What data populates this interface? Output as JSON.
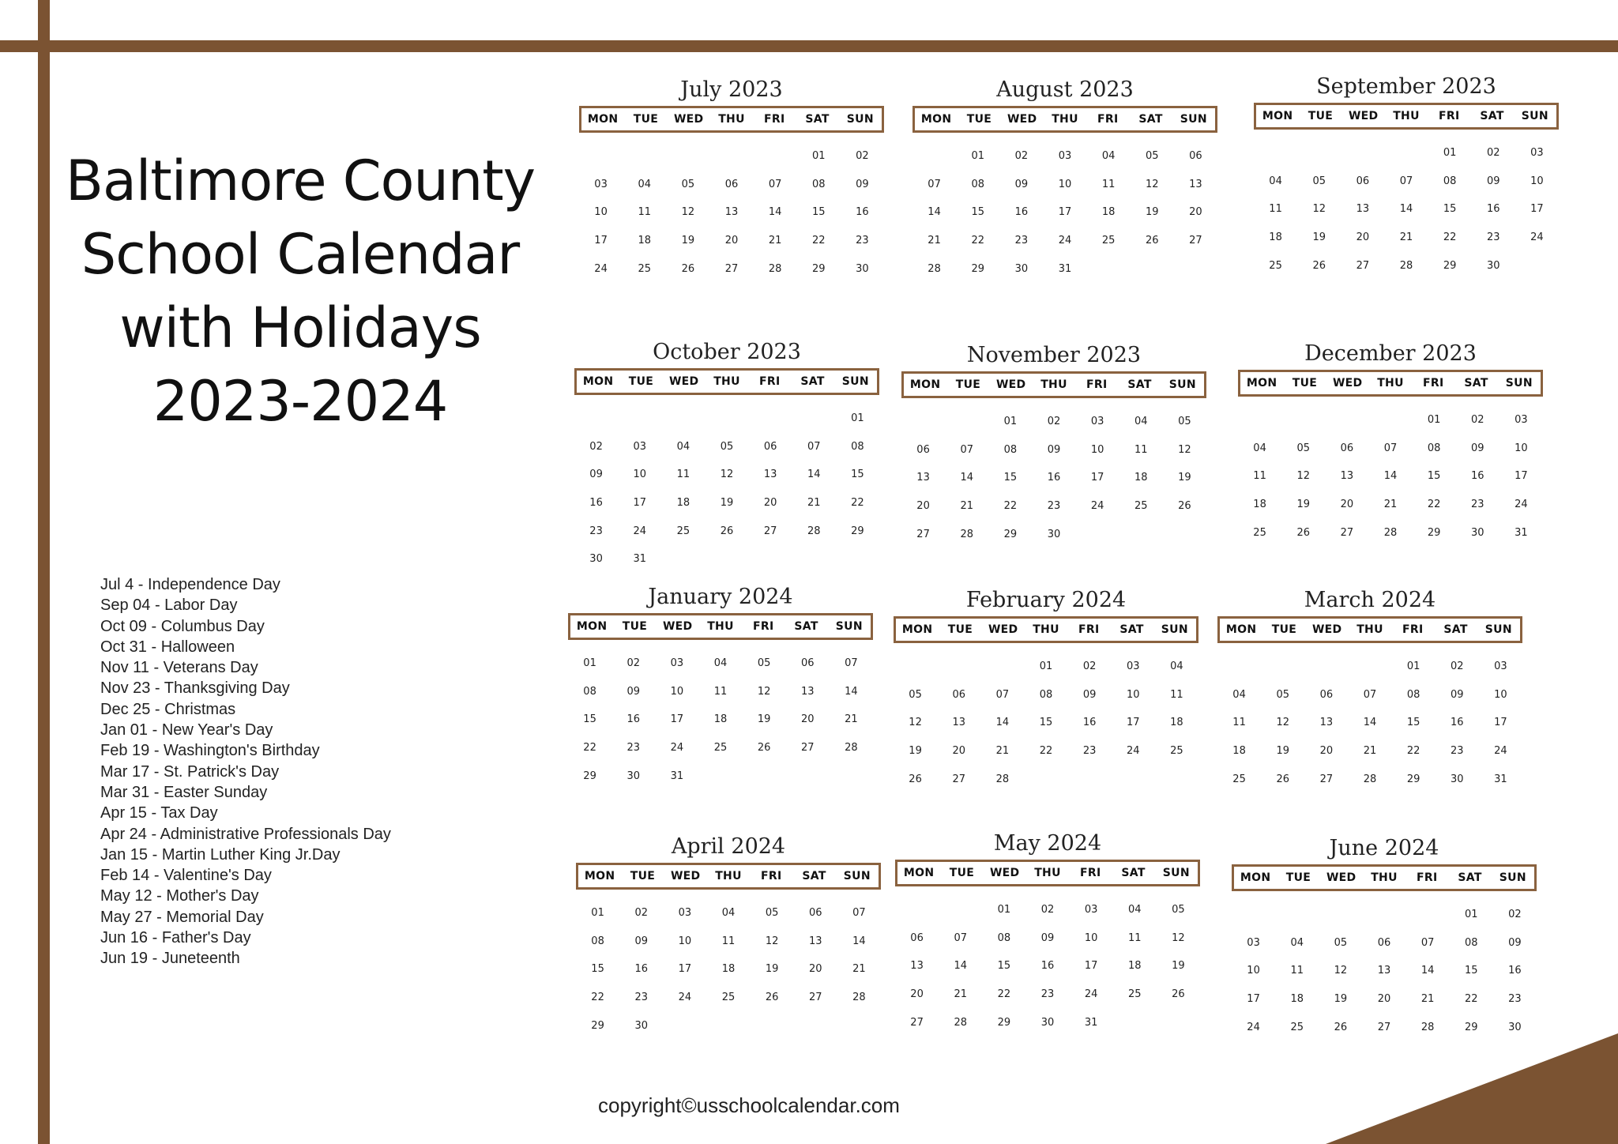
{
  "title": "Baltimore County School Calendar with Holidays 2023-2024",
  "title_lines": [
    "Baltimore County",
    "School Calendar",
    "with Holidays",
    "2023-2024"
  ],
  "weekday_labels": [
    "MON",
    "TUE",
    "WED",
    "THU",
    "FRI",
    "SAT",
    "SUN"
  ],
  "accent_color": "#7b5332",
  "months": [
    {
      "name": "July 2023",
      "offset": 5,
      "days": 30
    },
    {
      "name": "August 2023",
      "offset": 1,
      "days": 31
    },
    {
      "name": "September 2023",
      "offset": 4,
      "days": 30
    },
    {
      "name": "October 2023",
      "offset": 6,
      "days": 31
    },
    {
      "name": "November 2023",
      "offset": 2,
      "days": 30
    },
    {
      "name": "December 2023",
      "offset": 4,
      "days": 31
    },
    {
      "name": "January 2024",
      "offset": 0,
      "days": 31
    },
    {
      "name": "February 2024",
      "offset": 3,
      "days": 28
    },
    {
      "name": "March 2024",
      "offset": 4,
      "days": 31
    },
    {
      "name": "April 2024",
      "offset": 0,
      "days": 30
    },
    {
      "name": "May 2024",
      "offset": 2,
      "days": 31
    },
    {
      "name": "June 2024",
      "offset": 5,
      "days": 30
    }
  ],
  "holidays": [
    "Jul 4 - Independence Day",
    "Sep 04 - Labor Day",
    "Oct 09 - Columbus Day",
    "Oct 31 - Halloween",
    "Nov 11 - Veterans Day",
    "Nov 23 - Thanksgiving Day",
    "Dec 25 - Christmas",
    "Jan 01 - New Year's Day",
    "Feb 19 - Washington's Birthday",
    "Mar 17 - St. Patrick's Day",
    "Mar 31 - Easter Sunday",
    "Apr 15 - Tax Day",
    "Apr 24 - Administrative Professionals Day",
    "Jan 15 - Martin Luther King Jr.Day",
    "Feb 14 - Valentine's Day",
    "May 12 - Mother's Day",
    "May 27 - Memorial Day",
    "Jun 16 - Father's Day",
    "Jun 19 - Juneteenth"
  ],
  "copyright": "copyright©usschoolcalendar.com"
}
